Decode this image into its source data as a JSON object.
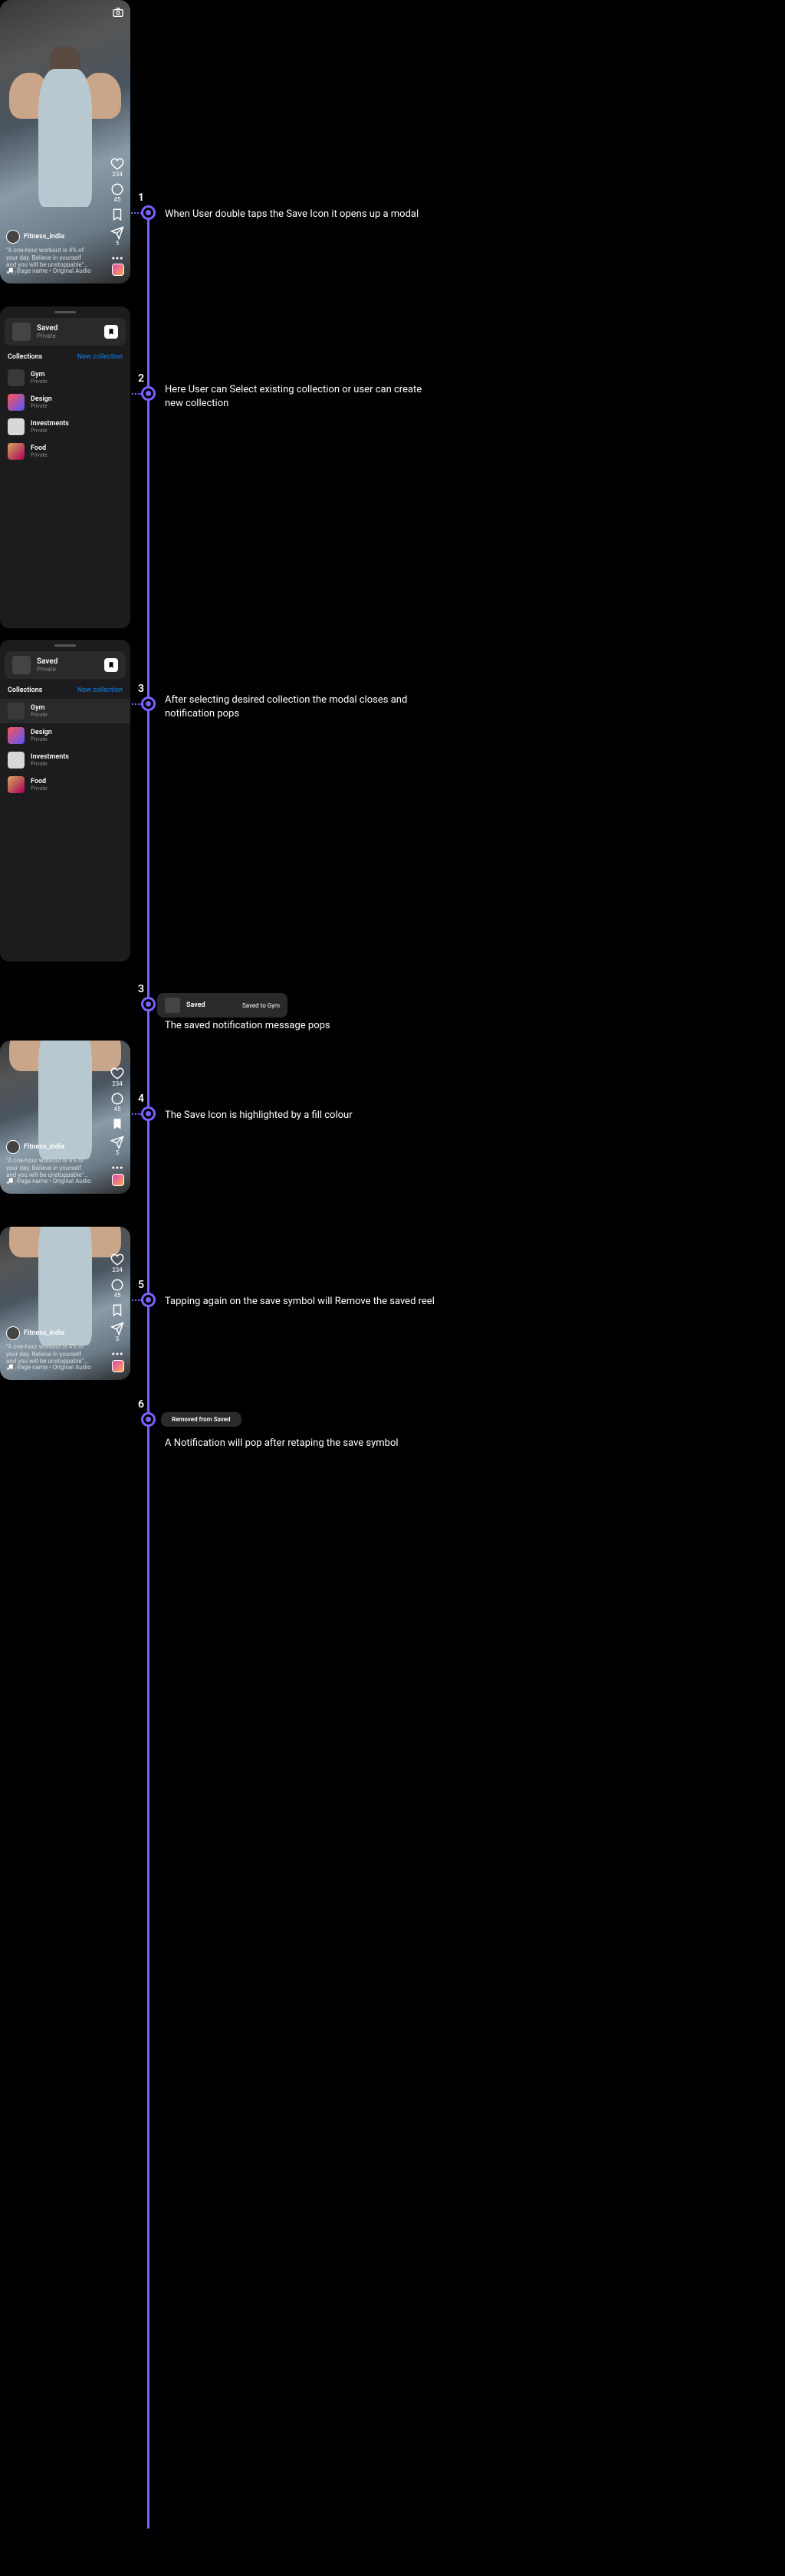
{
  "timeline": {
    "steps": [
      {
        "num": "1",
        "caption": "When User double taps the Save Icon it opens up a modal"
      },
      {
        "num": "2",
        "caption": "Here User can Select existing collection or user can create new collection"
      },
      {
        "num": "3",
        "caption": "After selecting desired collection the modal closes and notification pops"
      },
      {
        "num": "3",
        "caption": "The saved notification message pops"
      },
      {
        "num": "4",
        "caption": "The Save Icon is highlighted by a fill colour"
      },
      {
        "num": "5",
        "caption": "Tapping again on the save symbol will Remove the saved reel"
      },
      {
        "num": "6",
        "caption": "A Notification will pop after retaping the save symbol"
      }
    ]
  },
  "reel": {
    "username": "Fitness_india",
    "description": "\"A one-hour workout is 4% of your day. Believe in yourself and you will be unstoppable\"…",
    "more": "more",
    "audio": "Page name • Original Audio",
    "likes": "234",
    "comments": "45",
    "shares": "5"
  },
  "modal": {
    "saved_title": "Saved",
    "saved_sub": "Private",
    "collections_label": "Collections",
    "new_collection": "New collection",
    "items": [
      {
        "name": "Gym",
        "sub": "Private",
        "color": "#3a3a3a"
      },
      {
        "name": "Design",
        "sub": "Private",
        "color": "#5a7bd4"
      },
      {
        "name": "Investments",
        "sub": "Private",
        "color": "#d8d8d8"
      },
      {
        "name": "Food",
        "sub": "Private",
        "color": "#d4a860"
      }
    ]
  },
  "toast_saved": {
    "text": "Saved",
    "action": "Saved to Gym"
  },
  "toast_removed": {
    "text": "Removed from Saved"
  }
}
